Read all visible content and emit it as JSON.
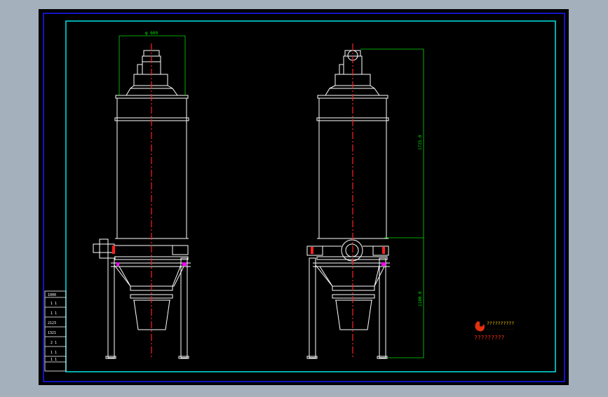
{
  "colors": {
    "viewport_bg": "#a5b0bd",
    "sheet_bg": "#000000",
    "outer_border": "#1a1aff",
    "inner_border": "#00e5e5",
    "outline": "#ffffff",
    "centerline": "#ff2020",
    "dimension": "#00dd00",
    "marker": "#ff00ff",
    "logo_text": "#ffd000",
    "logo_mark": "#e03010"
  },
  "drawing": {
    "left_view": {
      "dimension_top": "φ 600"
    },
    "right_view": {
      "dimension_upper": "1725.0",
      "dimension_lower": "1100.0"
    },
    "title_block": {
      "rows": [
        "1000",
        "1 1",
        "1 1",
        "2123",
        "1321",
        "2 1",
        "1 1",
        "1 1"
      ]
    },
    "logo": {
      "line1": "??????????",
      "line2": "· · · · · · · · · · ·",
      "line3": "?????????"
    }
  }
}
